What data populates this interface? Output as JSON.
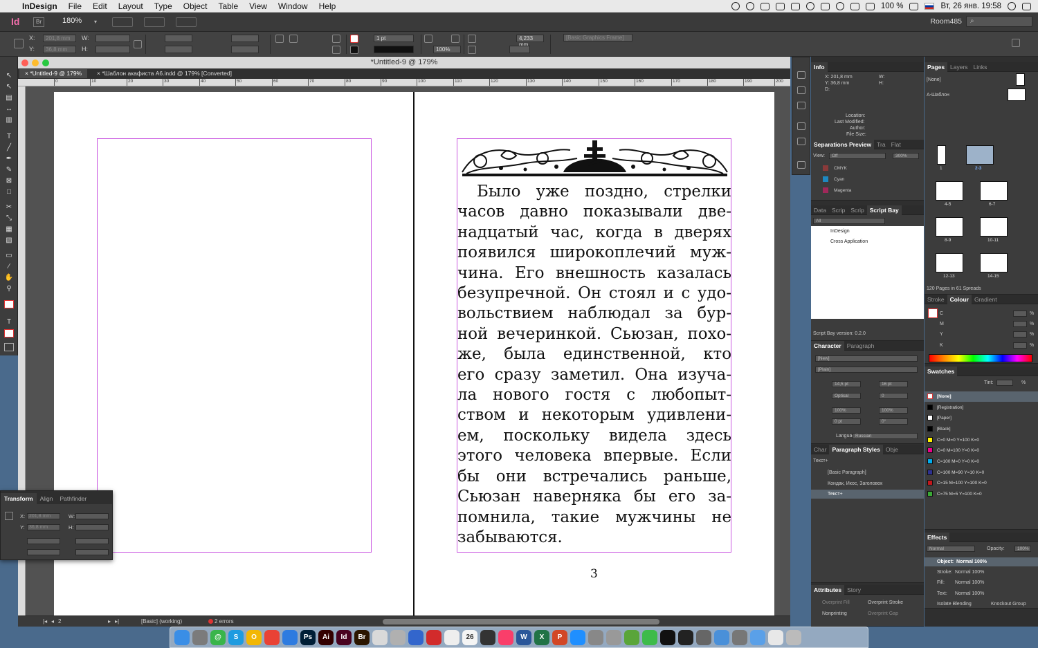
{
  "menubar": {
    "app": "InDesign",
    "items": [
      "File",
      "Edit",
      "Layout",
      "Type",
      "Object",
      "Table",
      "View",
      "Window",
      "Help"
    ],
    "battery": "100 %",
    "clock": "Вт, 26 янв. 19:58"
  },
  "appbar": {
    "logo": "Id",
    "bridge": "Br",
    "zoom": "180%",
    "workspace": "Room485",
    "search_placeholder": "⌕"
  },
  "control": {
    "x_label": "X:",
    "x_value": "201,8 mm",
    "y_label": "Y:",
    "y_value": "36,8 mm",
    "w_label": "W:",
    "h_label": "H:",
    "stroke_weight": "1 pt",
    "opacity": "100%",
    "gap": "4,233 mm",
    "frame_style": "[Basic Graphics Frame]"
  },
  "document": {
    "window_title": "*Untitled-9 @ 179%",
    "tabs": [
      "*Untitled-9 @ 179%",
      "*Шаблон акафиста А6.indd @ 179% [Converted]"
    ],
    "ruler_ticks": [
      "0",
      "10",
      "20",
      "30",
      "40",
      "50",
      "60",
      "70",
      "80",
      "90",
      "100",
      "110",
      "120",
      "130",
      "140",
      "150",
      "160",
      "170",
      "180",
      "190",
      "200"
    ],
    "story_lines": [
      "Было уже поздно, стрелки",
      "часов давно показывали две-",
      "надцатый час, когда в дверях",
      "появился широкоплечий муж-",
      "чина. Его внешность казалась",
      "безупречной. Он стоял и с удо-",
      "вольствием наблюдал за бур-",
      "ной вечеринкой. Сьюзан, похо-",
      "же, была единственной, кто",
      "его сразу заметил. Она изуча-",
      "ла нового гостя с любопыт-",
      "ством и некоторым удивлени-",
      "ем, поскольку видела здесь",
      "этого человека впервые. Если",
      "бы они встречались раньше,",
      "Сьюзан наверняка бы его за-",
      "помнила, такие мужчины не",
      "забываются."
    ],
    "page_number": "3",
    "status": {
      "page": "2",
      "preflight_profile": "[Basic] (working)",
      "errors": "2 errors"
    }
  },
  "transform_panel": {
    "tabs": [
      "Transform",
      "Align",
      "Pathfinder"
    ],
    "x_label": "X:",
    "x_value": "201,8 mm",
    "y_label": "Y:",
    "y_value": "36,8 mm",
    "w_label": "W:",
    "h_label": "H:"
  },
  "info_panel": {
    "title": "Info",
    "x": "X: 201,8 mm",
    "y": "Y: 36,8 mm",
    "d": "D:",
    "w": "W:",
    "h": "H:",
    "location": "Location:",
    "last_modified": "Last Modified:",
    "author": "Author:",
    "file_size": "File Size:"
  },
  "separations": {
    "tabs": [
      "Separations Preview",
      "Tra",
      "Flat"
    ],
    "view_label": "View:",
    "view_value": "Off",
    "zoom": "300%",
    "inks": [
      {
        "name": "CMYK",
        "color": "#8a3a3a"
      },
      {
        "name": "Cyan",
        "color": "#1e88c0"
      },
      {
        "name": "Magenta",
        "color": "#a0285a"
      }
    ]
  },
  "scriptbay": {
    "tabs": [
      "Data",
      "Scrip",
      "Scrip",
      "Script Bay"
    ],
    "filter": "All",
    "folders": [
      "InDesign",
      "Cross Application"
    ],
    "version": "Script Bay version: 0.2.0"
  },
  "character": {
    "tabs": [
      "Character",
      "Paragraph"
    ],
    "font": "[New]",
    "style": "[Plain]",
    "size": "14,5 pt",
    "leading": "16 pt",
    "kerning": "Optical",
    "tracking": "0",
    "vscale": "100%",
    "hscale": "100%",
    "baseline": "0 pt",
    "skew": "0°",
    "language_label": "Language:",
    "language": "Russian"
  },
  "para_styles": {
    "tabs": [
      "Char",
      "Paragraph Styles",
      "Obje"
    ],
    "current": "Текст+",
    "items": [
      "[Basic Paragraph]",
      "Кондак, Икос, Заголовок",
      "Текст+"
    ]
  },
  "attributes": {
    "tabs": [
      "Attributes",
      "Story"
    ],
    "items": [
      "Overprint Fill",
      "Overprint Stroke",
      "Nonprinting",
      "Overprint Gap"
    ]
  },
  "pages": {
    "tabs": [
      "Pages",
      "Layers",
      "Links"
    ],
    "none_label": "[None]",
    "master_label": "А-Шаблон",
    "spreads": [
      "1",
      "2-3",
      "4-5",
      "6-7",
      "8-9",
      "10-11",
      "12-13",
      "14-15"
    ],
    "footer": "120 Pages in 61 Spreads"
  },
  "colour": {
    "tabs": [
      "Stroke",
      "Colour",
      "Gradient"
    ],
    "channels": [
      "C",
      "M",
      "Y",
      "K"
    ],
    "unit": "%"
  },
  "swatches": {
    "title": "Swatches",
    "tint_label": "Tint:",
    "tint_unit": "%",
    "items": [
      {
        "name": "[None]",
        "color": "#ffffff"
      },
      {
        "name": "[Registration]",
        "color": "#000000"
      },
      {
        "name": "[Paper]",
        "color": "#ffffff"
      },
      {
        "name": "[Black]",
        "color": "#000000"
      },
      {
        "name": "C=0 M=0 Y=100 K=0",
        "color": "#fff200"
      },
      {
        "name": "C=0 M=100 Y=0 K=0",
        "color": "#ec008c"
      },
      {
        "name": "C=100 M=0 Y=0 K=0",
        "color": "#00aeef"
      },
      {
        "name": "C=100 M=90 Y=10 K=0",
        "color": "#2e3192"
      },
      {
        "name": "C=15 M=100 Y=100 K=0",
        "color": "#c4161c"
      },
      {
        "name": "C=75 M=5 Y=100 K=0",
        "color": "#3aaa35"
      }
    ]
  },
  "effects": {
    "title": "Effects",
    "blend": "Normal",
    "opacity_label": "Opacity:",
    "opacity": "100%",
    "rows": [
      {
        "label": "Object:",
        "value": "Normal 100%"
      },
      {
        "label": "Stroke:",
        "value": "Normal 100%"
      },
      {
        "label": "Fill:",
        "value": "Normal 100%"
      },
      {
        "label": "Text:",
        "value": "Normal 100%"
      }
    ],
    "isolate": "Isolate Blending",
    "knockout": "Knockout Group"
  },
  "dock": {
    "apps": [
      {
        "label": "",
        "color": "#3a8ee6"
      },
      {
        "label": "",
        "color": "#7b7b7b"
      },
      {
        "label": "@",
        "color": "#39b54a"
      },
      {
        "label": "S",
        "color": "#1e9be0"
      },
      {
        "label": "O",
        "color": "#f2b705"
      },
      {
        "label": "",
        "color": "#e94235"
      },
      {
        "label": "",
        "color": "#2d7be0"
      },
      {
        "label": "Ps",
        "color": "#001e36"
      },
      {
        "label": "Ai",
        "color": "#330000"
      },
      {
        "label": "Id",
        "color": "#49021f"
      },
      {
        "label": "Br",
        "color": "#2b1600"
      },
      {
        "label": "",
        "color": "#d9d9d9"
      },
      {
        "label": "",
        "color": "#b0b0b0"
      },
      {
        "label": "",
        "color": "#3366cc"
      },
      {
        "label": "",
        "color": "#d22b2b"
      },
      {
        "label": "",
        "color": "#eeeeee"
      },
      {
        "label": "26",
        "color": "#f4f4f4"
      },
      {
        "label": "",
        "color": "#333333"
      },
      {
        "label": "",
        "color": "#fa3e6a"
      },
      {
        "label": "W",
        "color": "#2b579a"
      },
      {
        "label": "X",
        "color": "#217346"
      },
      {
        "label": "P",
        "color": "#d24726"
      },
      {
        "label": "",
        "color": "#1f8fff"
      },
      {
        "label": "",
        "color": "#888888"
      },
      {
        "label": "",
        "color": "#999999"
      },
      {
        "label": "",
        "color": "#5aa53a"
      },
      {
        "label": "",
        "color": "#3dbb4a"
      },
      {
        "label": "",
        "color": "#111111"
      },
      {
        "label": "",
        "color": "#222222"
      },
      {
        "label": "",
        "color": "#666666"
      },
      {
        "label": "",
        "color": "#4a90d9"
      },
      {
        "label": "",
        "color": "#777777"
      },
      {
        "label": "",
        "color": "#5aa0e8"
      },
      {
        "label": "",
        "color": "#e8e8e8"
      },
      {
        "label": "",
        "color": "#bbbbbb"
      }
    ]
  }
}
